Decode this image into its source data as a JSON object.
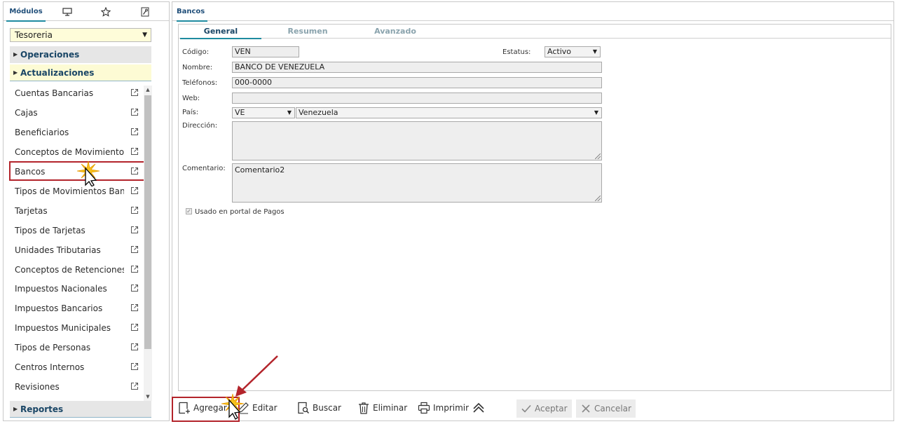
{
  "left_panel": {
    "tabs": {
      "modulos": "Módulos"
    },
    "module_select": "Tesoreria",
    "sections": {
      "operaciones": "Operaciones",
      "actualizaciones": "Actualizaciones",
      "reportes": "Reportes"
    },
    "menu_items": [
      "Cuentas Bancarias",
      "Cajas",
      "Beneficiarios",
      "Conceptos de Movimientos",
      "Bancos",
      "Tipos de Movimientos Bancarios",
      "Tarjetas",
      "Tipos de Tarjetas",
      "Unidades Tributarias",
      "Conceptos de Retenciones",
      "Impuestos Nacionales",
      "Impuestos Bancarios",
      "Impuestos Municipales",
      "Tipos de Personas",
      "Centros Internos",
      "Revisiones"
    ]
  },
  "right_panel": {
    "title": "Bancos",
    "sub_tabs": {
      "general": "General",
      "resumen": "Resumen",
      "avanzado": "Avanzado"
    },
    "form": {
      "codigo_label": "Código:",
      "codigo_value": "VEN",
      "estatus_label": "Estatus:",
      "estatus_value": "Activo",
      "nombre_label": "Nombre:",
      "nombre_value": "BANCO DE VENEZUELA",
      "telefonos_label": "Teléfonos:",
      "telefonos_value": "000-0000",
      "web_label": "Web:",
      "web_value": "",
      "pais_label": "País:",
      "pais_code": "VE",
      "pais_name": "Venezuela",
      "direccion_label": "Dirección:",
      "direccion_value": "",
      "comentario_label": "Comentario:",
      "comentario_value": "Comentario2",
      "portal_label": "Usado en portal de Pagos"
    },
    "toolbar": {
      "agregar": "Agregar",
      "editar": "Editar",
      "buscar": "Buscar",
      "eliminar": "Eliminar",
      "imprimir": "Imprimir",
      "aceptar": "Aceptar",
      "cancelar": "Cancelar"
    }
  },
  "colors": {
    "accent": "#1f8ba0",
    "highlight_box": "#b3242b",
    "section_yellow": "#fdfbd4",
    "select_yellow": "#fefcd9"
  }
}
